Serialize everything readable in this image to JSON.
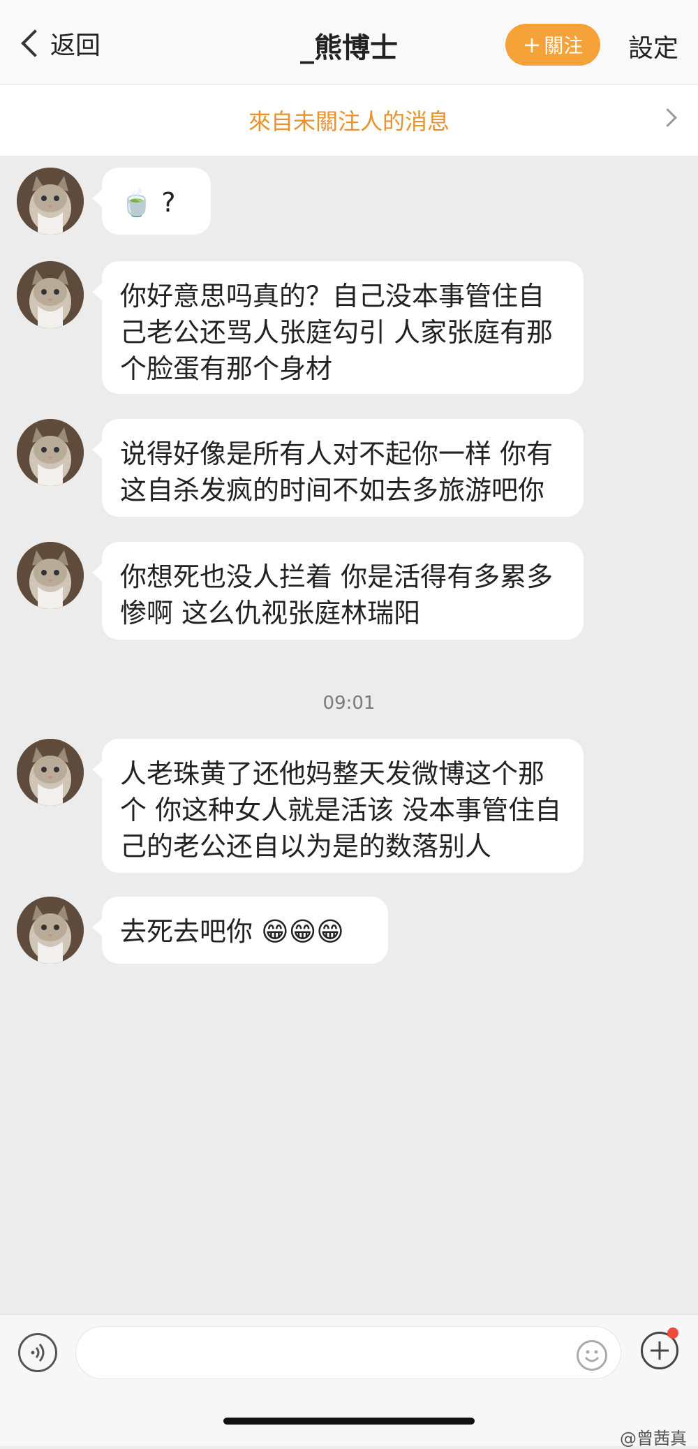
{
  "header": {
    "back_label": "返回",
    "title": "_熊博士",
    "follow_label": "關注",
    "follow_plus": "+",
    "settings_label": "設定"
  },
  "notice": {
    "text": "來自未關注人的消息"
  },
  "messages": [
    {
      "text": "🍵 ?"
    },
    {
      "text": "你好意思吗真的？自己没本事管住自己老公还骂人张庭勾引 人家张庭有那个脸蛋有那个身材"
    },
    {
      "text": "说得好像是所有人对不起你一样 你有这自杀发疯的时间不如去多旅游吧你"
    },
    {
      "text": "你想死也没人拦着 你是活得有多累多惨啊 这么仇视张庭林瑞阳"
    },
    {
      "text": "人老珠黄了还他妈整天发微博这个那个 你这种女人就是活该 没本事管住自己的老公还自以为是的数落别人"
    },
    {
      "text": "去死去吧你 😁😁😁"
    }
  ],
  "timestamp": "09:01",
  "input": {
    "placeholder": ""
  },
  "watermark": "@曾茜真",
  "colors": {
    "accent": "#f5a239",
    "notice_text": "#e8912d",
    "badge": "#f04a3c"
  },
  "icons": [
    "back-chevron-icon",
    "plus-icon",
    "chevron-right-icon",
    "voice-icon",
    "emoji-icon",
    "plus-circle-icon"
  ]
}
